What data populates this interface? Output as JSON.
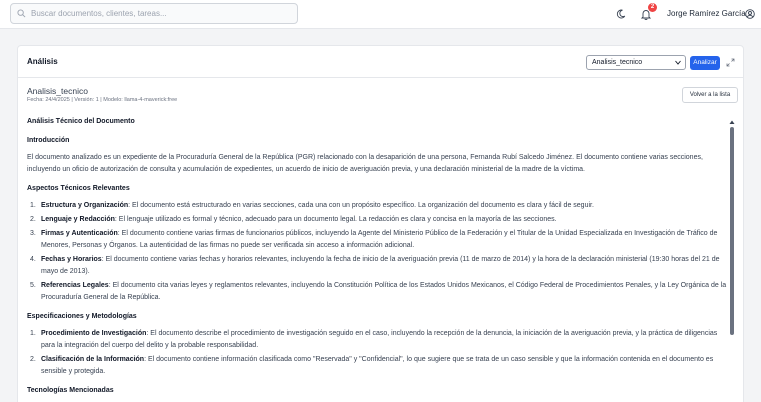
{
  "header": {
    "search_placeholder": "Buscar documentos, clientes, tareas...",
    "notification_count": "2",
    "user_name": "Jorge Ramírez García"
  },
  "card": {
    "title": "Análisis",
    "select_value": "Analisis_tecnico",
    "analyze_label": "Analizar",
    "doc_title": "Analisis_tecnico",
    "doc_meta": "Fecha: 24/4/2025 | Versión: 1 | Modelo: llama-4-maverick:free",
    "back_label": "Volver a la lista"
  },
  "content": {
    "doc_heading": "Análisis Técnico del Documento",
    "intro_heading": "Introducción",
    "intro_text": "El documento analizado es un expediente de la Procuraduría General de la República (PGR) relacionado con la desaparición de una persona, Fernanda Rubí Salcedo Jiménez. El documento contiene varias secciones, incluyendo un oficio de autorización de consulta y acumulación de expedientes, un acuerdo de inicio de averiguación previa, y una declaración ministerial de la madre de la víctima.",
    "aspects_heading": "Aspectos Técnicos Relevantes",
    "aspects": [
      {
        "num": "1.",
        "term": "Estructura y Organización",
        "text": ": El documento está estructurado en varias secciones, cada una con un propósito específico. La organización del documento es clara y fácil de seguir."
      },
      {
        "num": "2.",
        "term": "Lenguaje y Redacción",
        "text": ": El lenguaje utilizado es formal y técnico, adecuado para un documento legal. La redacción es clara y concisa en la mayoría de las secciones."
      },
      {
        "num": "3.",
        "term": "Firmas y Autenticación",
        "text": ": El documento contiene varias firmas de funcionarios públicos, incluyendo la Agente del Ministerio Público de la Federación y el Titular de la Unidad Especializada en Investigación de Tráfico de Menores, Personas y Órganos. La autenticidad de las firmas no puede ser verificada sin acceso a información adicional."
      },
      {
        "num": "4.",
        "term": "Fechas y Horarios",
        "text": ": El documento contiene varias fechas y horarios relevantes, incluyendo la fecha de inicio de la averiguación previa (11 de marzo de 2014) y la hora de la declaración ministerial (19:30 horas del 21 de mayo de 2013)."
      },
      {
        "num": "5.",
        "term": "Referencias Legales",
        "text": ": El documento cita varias leyes y reglamentos relevantes, incluyendo la Constitución Política de los Estados Unidos Mexicanos, el Código Federal de Procedimientos Penales, y la Ley Orgánica de la Procuraduría General de la República."
      }
    ],
    "specs_heading": "Especificaciones y Metodologías",
    "specs": [
      {
        "num": "1.",
        "term": "Procedimiento de Investigación",
        "text": ": El documento describe el procedimiento de investigación seguido en el caso, incluyendo la recepción de la denuncia, la iniciación de la averiguación previa, y la práctica de diligencias para la integración del cuerpo del delito y la probable responsabilidad."
      },
      {
        "num": "2.",
        "term": "Clasificación de la Información",
        "text": ": El documento contiene información clasificada como \"Reservada\" y \"Confidencial\", lo que sugiere que se trata de un caso sensible y que la información contenida en el documento es sensible y protegida."
      }
    ],
    "tech_heading": "Tecnologías Mencionadas"
  }
}
